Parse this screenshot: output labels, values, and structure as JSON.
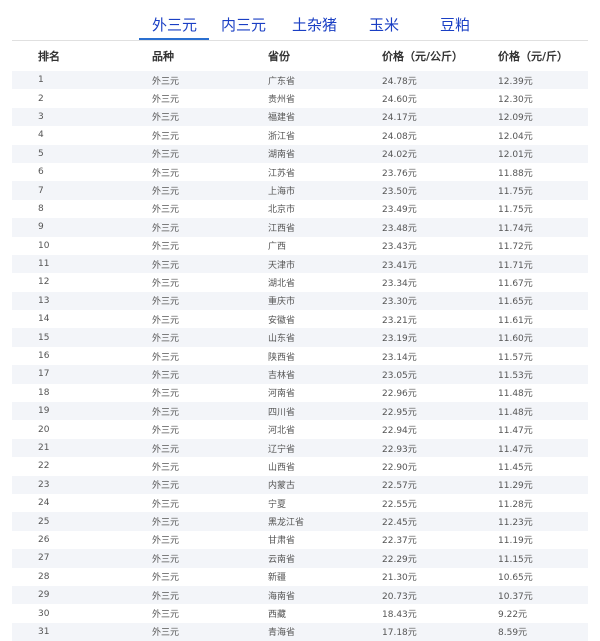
{
  "tabs": [
    {
      "label": "外三元",
      "active": true
    },
    {
      "label": "内三元",
      "active": false
    },
    {
      "label": "土杂猪",
      "active": false
    },
    {
      "label": "玉米",
      "active": false
    },
    {
      "label": "豆粕",
      "active": false
    }
  ],
  "table": {
    "headers": [
      "排名",
      "品种",
      "省份",
      "价格（元/公斤）",
      "价格（元/斤）"
    ],
    "rows": [
      [
        "1",
        "外三元",
        "广东省",
        "24.78元",
        "12.39元"
      ],
      [
        "2",
        "外三元",
        "贵州省",
        "24.60元",
        "12.30元"
      ],
      [
        "3",
        "外三元",
        "福建省",
        "24.17元",
        "12.09元"
      ],
      [
        "4",
        "外三元",
        "浙江省",
        "24.08元",
        "12.04元"
      ],
      [
        "5",
        "外三元",
        "湖南省",
        "24.02元",
        "12.01元"
      ],
      [
        "6",
        "外三元",
        "江苏省",
        "23.76元",
        "11.88元"
      ],
      [
        "7",
        "外三元",
        "上海市",
        "23.50元",
        "11.75元"
      ],
      [
        "8",
        "外三元",
        "北京市",
        "23.49元",
        "11.75元"
      ],
      [
        "9",
        "外三元",
        "江西省",
        "23.48元",
        "11.74元"
      ],
      [
        "10",
        "外三元",
        "广西",
        "23.43元",
        "11.72元"
      ],
      [
        "11",
        "外三元",
        "天津市",
        "23.41元",
        "11.71元"
      ],
      [
        "12",
        "外三元",
        "湖北省",
        "23.34元",
        "11.67元"
      ],
      [
        "13",
        "外三元",
        "重庆市",
        "23.30元",
        "11.65元"
      ],
      [
        "14",
        "外三元",
        "安徽省",
        "23.21元",
        "11.61元"
      ],
      [
        "15",
        "外三元",
        "山东省",
        "23.19元",
        "11.60元"
      ],
      [
        "16",
        "外三元",
        "陕西省",
        "23.14元",
        "11.57元"
      ],
      [
        "17",
        "外三元",
        "吉林省",
        "23.05元",
        "11.53元"
      ],
      [
        "18",
        "外三元",
        "河南省",
        "22.96元",
        "11.48元"
      ],
      [
        "19",
        "外三元",
        "四川省",
        "22.95元",
        "11.48元"
      ],
      [
        "20",
        "外三元",
        "河北省",
        "22.94元",
        "11.47元"
      ],
      [
        "21",
        "外三元",
        "辽宁省",
        "22.93元",
        "11.47元"
      ],
      [
        "22",
        "外三元",
        "山西省",
        "22.90元",
        "11.45元"
      ],
      [
        "23",
        "外三元",
        "内蒙古",
        "22.57元",
        "11.29元"
      ],
      [
        "24",
        "外三元",
        "宁夏",
        "22.55元",
        "11.28元"
      ],
      [
        "25",
        "外三元",
        "黑龙江省",
        "22.45元",
        "11.23元"
      ],
      [
        "26",
        "外三元",
        "甘肃省",
        "22.37元",
        "11.19元"
      ],
      [
        "27",
        "外三元",
        "云南省",
        "22.29元",
        "11.15元"
      ],
      [
        "28",
        "外三元",
        "新疆",
        "21.30元",
        "10.65元"
      ],
      [
        "29",
        "外三元",
        "海南省",
        "20.73元",
        "10.37元"
      ],
      [
        "30",
        "外三元",
        "西藏",
        "18.43元",
        "9.22元"
      ],
      [
        "31",
        "外三元",
        "青海省",
        "17.18元",
        "8.59元"
      ]
    ]
  }
}
